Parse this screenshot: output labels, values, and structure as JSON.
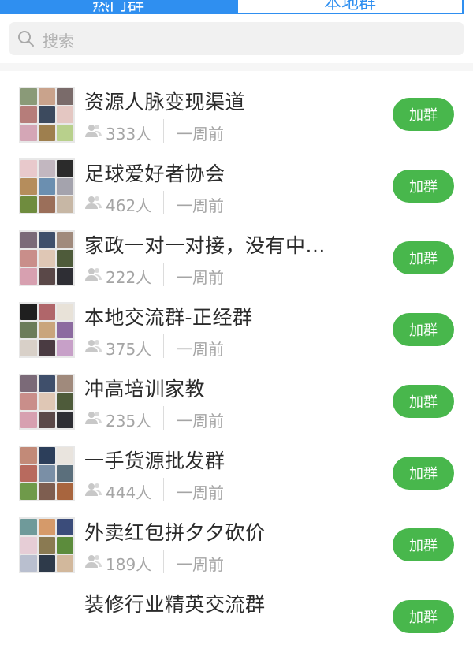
{
  "tabs": [
    {
      "label": "热门群",
      "active": true
    },
    {
      "label": "本地群",
      "active": false
    }
  ],
  "search": {
    "placeholder": "搜索"
  },
  "colors": {
    "accent": "#2f8ff0",
    "join": "#48b74c"
  },
  "groups": [
    {
      "name": "资源人脉变现渠道",
      "members": "333人",
      "time": "一周前",
      "action": "加群"
    },
    {
      "name": "足球爱好者协会",
      "members": "462人",
      "time": "一周前",
      "action": "加群"
    },
    {
      "name": "家政一对一对接，没有中...",
      "members": "222人",
      "time": "一周前",
      "action": "加群"
    },
    {
      "name": "本地交流群-正经群",
      "members": "375人",
      "time": "一周前",
      "action": "加群"
    },
    {
      "name": "冲高培训家教",
      "members": "235人",
      "time": "一周前",
      "action": "加群"
    },
    {
      "name": "一手货源批发群",
      "members": "444人",
      "time": "一周前",
      "action": "加群"
    },
    {
      "name": "外卖红包拼夕夕砍价",
      "members": "189人",
      "time": "一周前",
      "action": "加群"
    },
    {
      "name": "装修行业精英交流群",
      "members": "",
      "time": "",
      "action": "加群"
    }
  ]
}
